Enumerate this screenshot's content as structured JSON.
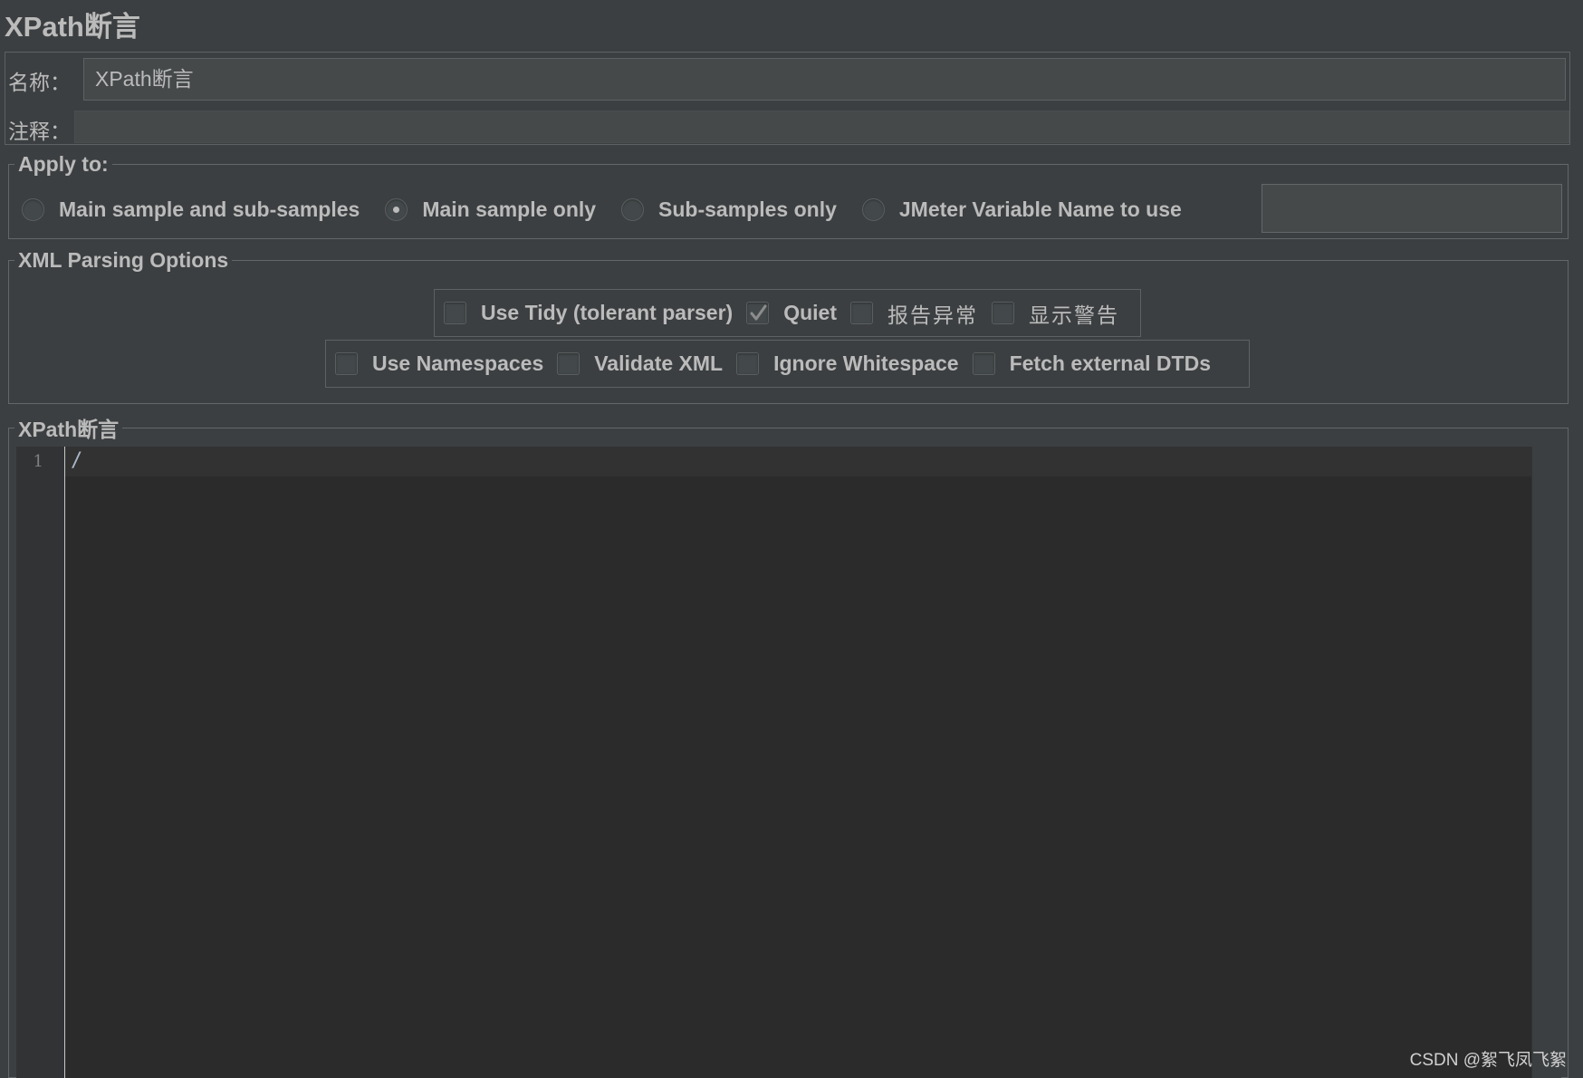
{
  "header": {
    "title": "XPath断言"
  },
  "name_row": {
    "label": "名称：",
    "value": "XPath断言"
  },
  "comment_row": {
    "label": "注释：",
    "value": ""
  },
  "apply_to": {
    "legend": "Apply to:",
    "options": [
      {
        "label": "Main sample and sub-samples",
        "selected": false
      },
      {
        "label": "Main sample only",
        "selected": true
      },
      {
        "label": "Sub-samples only",
        "selected": false
      },
      {
        "label": "JMeter Variable Name to use",
        "selected": false
      }
    ],
    "variable_value": ""
  },
  "xml_parsing": {
    "legend": "XML Parsing Options",
    "row1": [
      {
        "label": "Use Tidy (tolerant parser)",
        "checked": false
      },
      {
        "label": "Quiet",
        "checked": true
      },
      {
        "label": "报告异常",
        "checked": false
      },
      {
        "label": "显示警告",
        "checked": false
      }
    ],
    "row2": [
      {
        "label": "Use Namespaces",
        "checked": false
      },
      {
        "label": "Validate XML",
        "checked": false
      },
      {
        "label": "Ignore Whitespace",
        "checked": false
      },
      {
        "label": "Fetch external DTDs",
        "checked": false
      }
    ]
  },
  "xpath_assertion": {
    "legend": "XPath断言",
    "line_number": "1",
    "code": "/"
  },
  "watermark": "CSDN @絮飞凤飞絮"
}
